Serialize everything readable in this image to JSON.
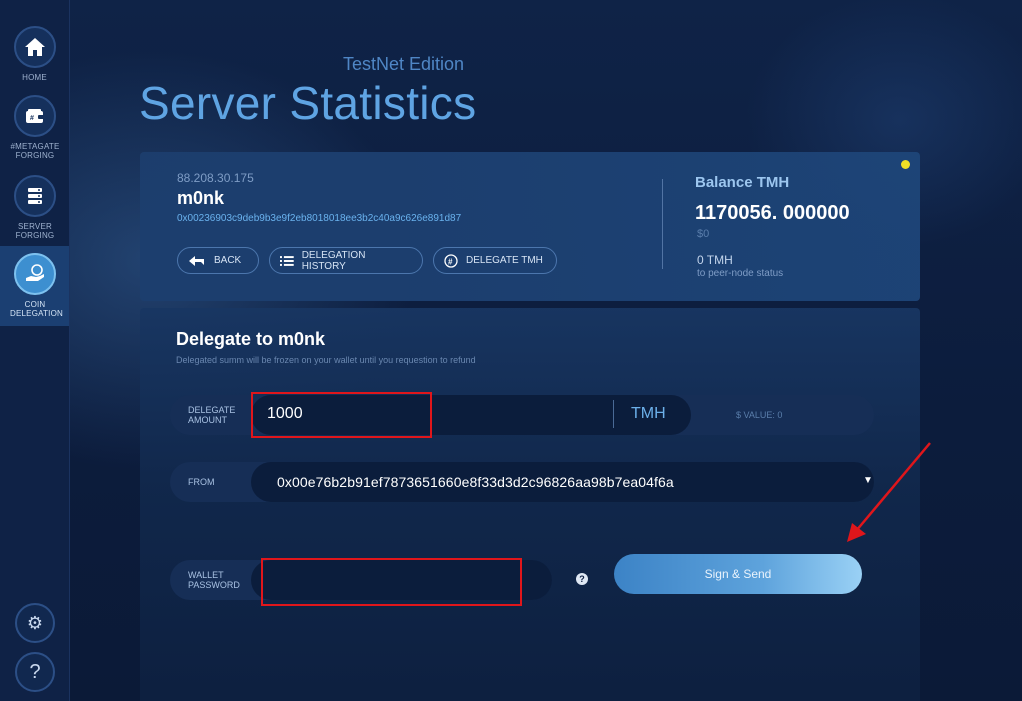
{
  "sidebar": {
    "items": [
      {
        "label": "HOME",
        "icon": "home-icon"
      },
      {
        "label": "#METAGATE FORGING",
        "icon": "wallet-icon"
      },
      {
        "label": "SERVER FORGING",
        "icon": "server-icon"
      },
      {
        "label": "COIN DELEGATION",
        "icon": "coin-hand-icon",
        "active": true
      }
    ],
    "bottom": [
      {
        "icon": "gear-icon",
        "glyph": "⚙"
      },
      {
        "icon": "help-icon",
        "glyph": "?"
      }
    ]
  },
  "header": {
    "edition": "TestNet Edition",
    "title": "Server Statistics"
  },
  "node": {
    "ip": "88.208.30.175",
    "name": "m0nk",
    "address": "0x00236903c9deb9b3e9f2eb8018018ee3b2c40a9c626e891d87",
    "buttons": {
      "back": "BACK",
      "history": "DELEGATION HISTORY",
      "delegate": "DELEGATE TMH"
    },
    "balance_label": "Balance TMH",
    "balance_value": "1170056. 000000",
    "balance_usd": "$0",
    "tmh_amount": "0 TMH",
    "tmh_note": "to peer-node status",
    "status_color": "#f0e025"
  },
  "form": {
    "title": "Delegate to m0nk",
    "subtitle": "Delegated summ will be frozen on your wallet until you requestion to refund",
    "amount_label_1": "DELEGATE",
    "amount_label_2": "AMOUNT",
    "amount_value": "1000",
    "unit": "TMH",
    "usd_value": "$ VALUE: 0",
    "from_label": "FROM",
    "from_address": "0x00e76b2b91ef7873651660e8f33d3d2c96826aa98b7ea04f6a",
    "password_label_1": "WALLET",
    "password_label_2": "PASSWORD",
    "password_value": "",
    "help_glyph": "?",
    "caret_glyph": "▼",
    "submit": "Sign & Send"
  },
  "annotation": {
    "highlight_color": "#e0161b"
  }
}
